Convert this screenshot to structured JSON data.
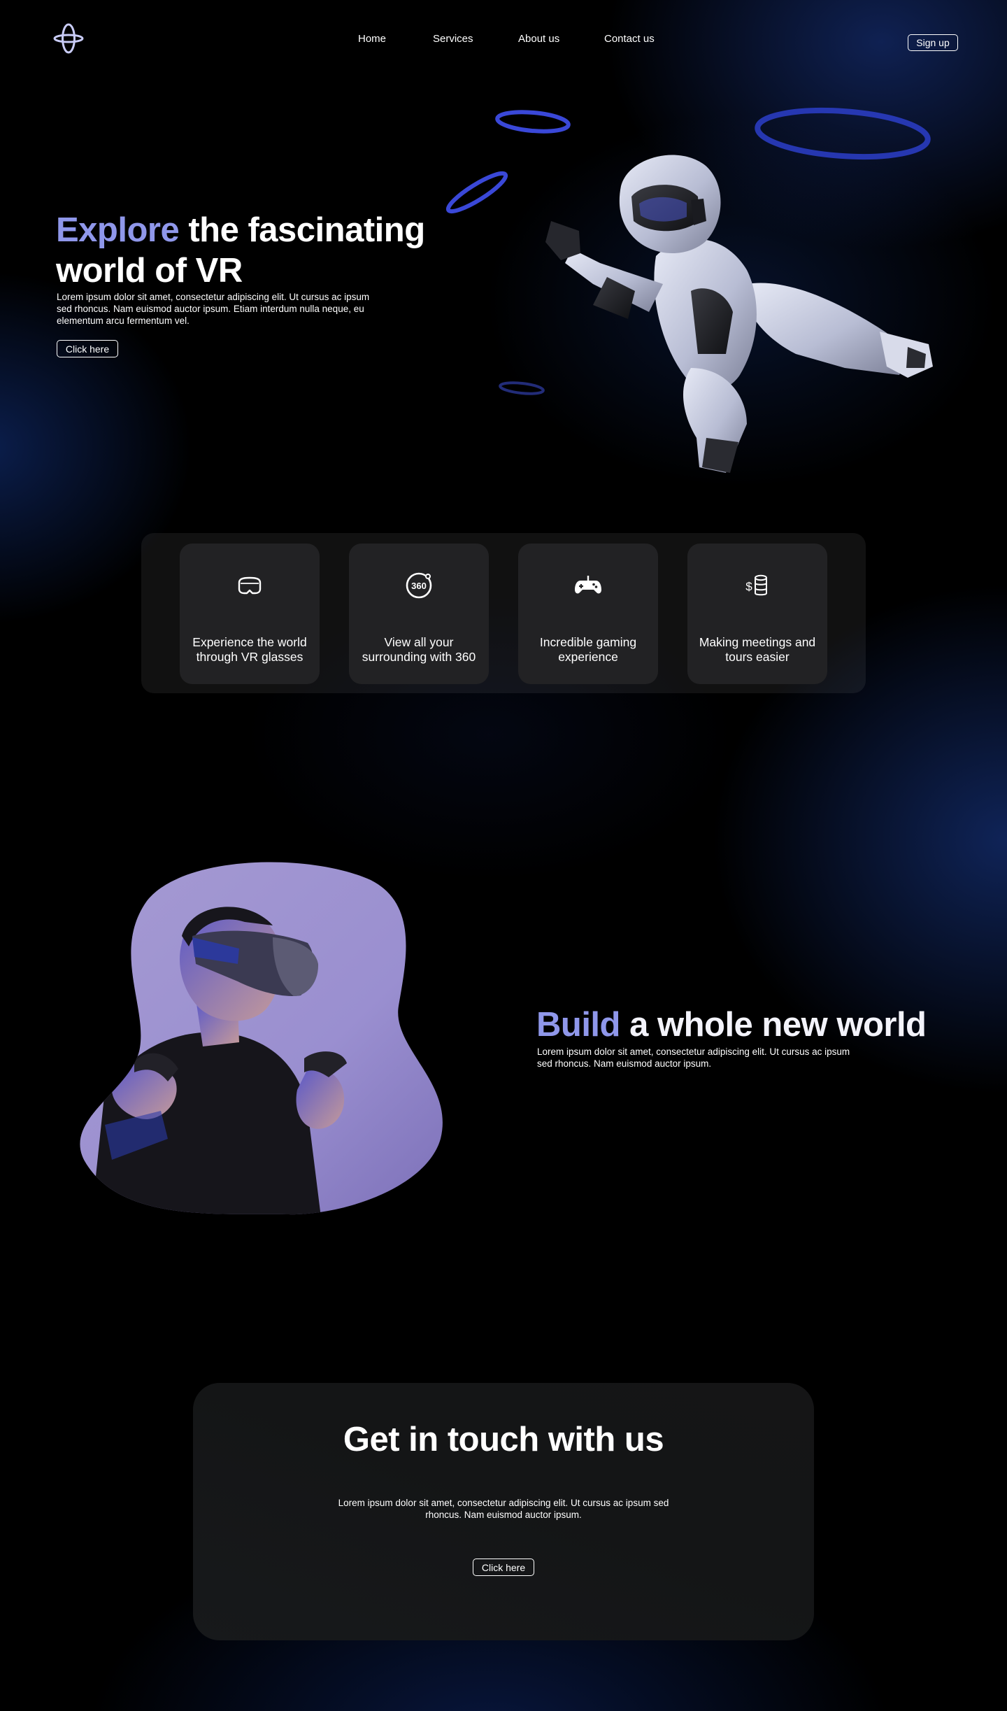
{
  "header": {
    "logo_icon": "orbit-logo-icon",
    "nav": [
      {
        "label": "Home"
      },
      {
        "label": "Services"
      },
      {
        "label": "About us"
      },
      {
        "label": "Contact us"
      }
    ],
    "signup_label": "Sign up"
  },
  "hero": {
    "title_accent": "Explore",
    "title_rest": " the fascinating world of VR",
    "description": "Lorem ipsum dolor sit amet, consectetur adipiscing elit. Ut cursus ac ipsum sed rhoncus. Nam euismod auctor ipsum. Etiam interdum nulla neque, eu elementum arcu fermentum vel.",
    "button_label": "Click here",
    "image": "flying-robot-illustration"
  },
  "features": [
    {
      "icon": "vr-headset-icon",
      "label": "Experience the world through VR glasses"
    },
    {
      "icon": "360-view-icon",
      "label": "View all your surrounding with 360",
      "icon_text": "360"
    },
    {
      "icon": "gamepad-icon",
      "label": "Incredible gaming experience"
    },
    {
      "icon": "coins-icon",
      "label": "Making meetings and tours easier",
      "icon_text": "$"
    }
  ],
  "build": {
    "title_accent": "Build",
    "title_rest": " a whole new world",
    "description": "Lorem ipsum dolor sit amet, consectetur adipiscing elit. Ut cursus ac ipsum sed rhoncus. Nam euismod auctor ipsum.",
    "image": "man-wearing-vr-headset-photo"
  },
  "contact": {
    "title": "Get in touch with us",
    "description": "Lorem ipsum dolor sit amet, consectetur adipiscing elit. Ut cursus ac ipsum sed rhoncus. Nam euismod auctor ipsum.",
    "button_label": "Click here"
  },
  "colors": {
    "background": "#000000",
    "accent": "#8f97ea",
    "glow_blue": "#1c3c96",
    "ring_blue": "#3a48d8",
    "card": "#222224",
    "contact_card": "#151516"
  }
}
